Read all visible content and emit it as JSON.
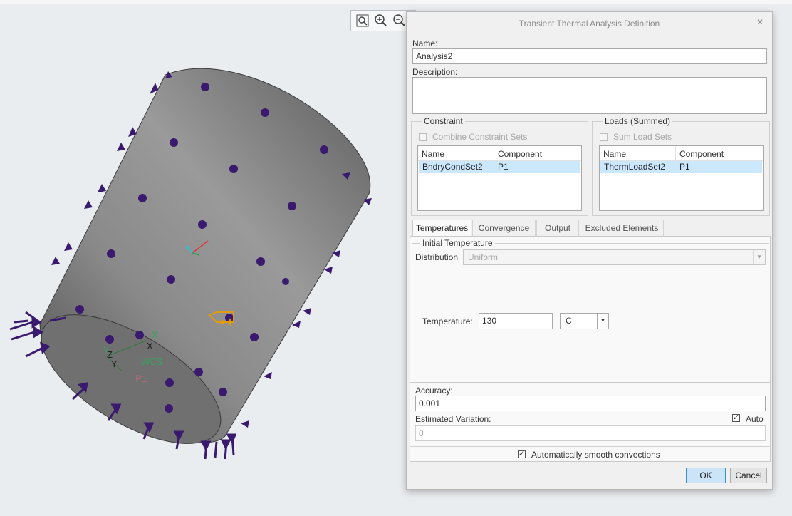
{
  "dialog": {
    "title": "Transient Thermal Analysis Definition",
    "close_glyph": "×",
    "name_label": "Name:",
    "name_value": "Analysis2",
    "description_label": "Description:",
    "description_value": ""
  },
  "constraint": {
    "group_title": "Constraint",
    "combine_label": "Combine Constraint Sets",
    "combine_checked": false,
    "columns": [
      "Name",
      "Component"
    ],
    "rows": [
      {
        "name": "BndryCondSet2",
        "component": "P1"
      }
    ]
  },
  "loads": {
    "group_title": "Loads (Summed)",
    "sum_label": "Sum Load Sets",
    "sum_checked": false,
    "columns": [
      "Name",
      "Component"
    ],
    "rows": [
      {
        "name": "ThermLoadSet2",
        "component": "P1"
      }
    ]
  },
  "tabs": [
    {
      "label": "Temperatures",
      "active": true
    },
    {
      "label": "Convergence",
      "active": false
    },
    {
      "label": "Output",
      "active": false
    },
    {
      "label": "Excluded Elements",
      "active": false
    }
  ],
  "temperatures": {
    "group_title": "Initial Temperature",
    "distribution_label": "Distribution",
    "distribution_value": "Uniform",
    "temperature_label": "Temperature:",
    "temperature_value": "130",
    "unit_value": "C"
  },
  "accuracy": {
    "label": "Accuracy:",
    "value": "0.001",
    "variation_label": "Estimated Variation:",
    "variation_value": "0",
    "auto_label": "Auto",
    "auto_checked": true
  },
  "smooth": {
    "label": "Automatically smooth convections",
    "checked": true
  },
  "buttons": {
    "ok": "OK",
    "cancel": "Cancel"
  },
  "model": {
    "csys_labels": [
      "X",
      "Z",
      "Y",
      "X",
      "Y",
      "WCS"
    ],
    "part_label": "P1"
  },
  "view_toolbar": {
    "icons": [
      "zoom-fit-icon",
      "zoom-in-icon",
      "zoom-out-icon"
    ]
  },
  "colors": {
    "marker": "#3a1a6e",
    "model_gray": "#7d7d7d",
    "accent": "#3b8fd8",
    "selection": "#cce8ff"
  }
}
